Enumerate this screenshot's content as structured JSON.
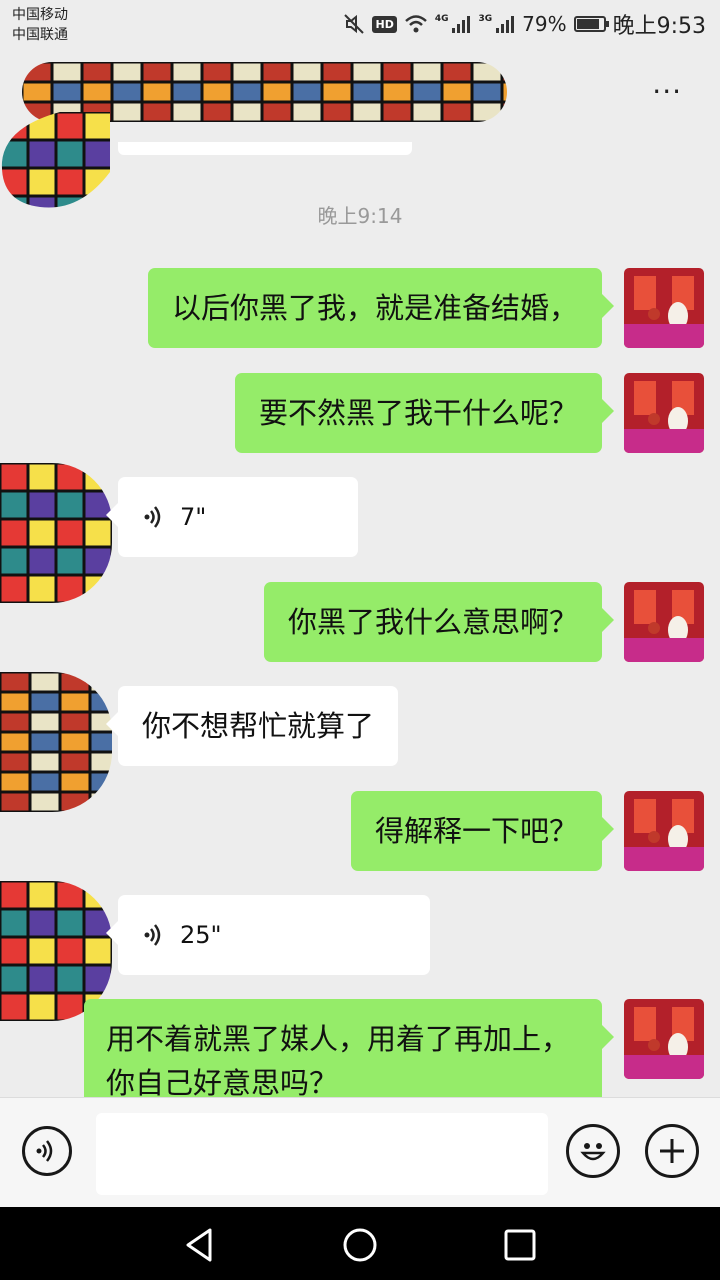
{
  "status_bar": {
    "carrier_1": "中国移动",
    "carrier_2": "中国联通",
    "hd_label": "HD",
    "net_1": "4G",
    "net_2": "3G",
    "battery_percent": "79%",
    "battery_level": 0.79,
    "time": "晚上9:53",
    "icons": [
      "mute-icon",
      "wifi-icon",
      "signal-icon",
      "battery-icon"
    ]
  },
  "header": {
    "more_label": "···",
    "more_icon": "more-dots-icon"
  },
  "chat": {
    "timestamp": "晚上9:14",
    "messages": [
      {
        "side": "out",
        "text": "以后你黑了我，就是准备结婚，"
      },
      {
        "side": "out",
        "text": "要不然黑了我干什么呢？"
      },
      {
        "side": "in",
        "type": "voice",
        "duration": "7\""
      },
      {
        "side": "out",
        "text": "你黑了我什么意思啊？"
      },
      {
        "side": "in",
        "text": "你不想帮忙就算了"
      },
      {
        "side": "out",
        "text": "得解释一下吧？"
      },
      {
        "side": "in",
        "type": "voice",
        "duration": "25\""
      },
      {
        "side": "out",
        "text": "用不着就黑了媒人，用着了再加上，你自己好意思吗？"
      }
    ]
  },
  "input_bar": {
    "voice_icon": "voice-input-icon",
    "emoji_icon": "emoji-icon",
    "plus_icon": "plus-icon",
    "input_value": ""
  },
  "nav_bar": {
    "icons": [
      "back-icon",
      "home-icon",
      "recents-icon"
    ]
  },
  "colors": {
    "background": "#ededed",
    "bubble_out": "#95ec69",
    "bubble_in": "#ffffff"
  }
}
